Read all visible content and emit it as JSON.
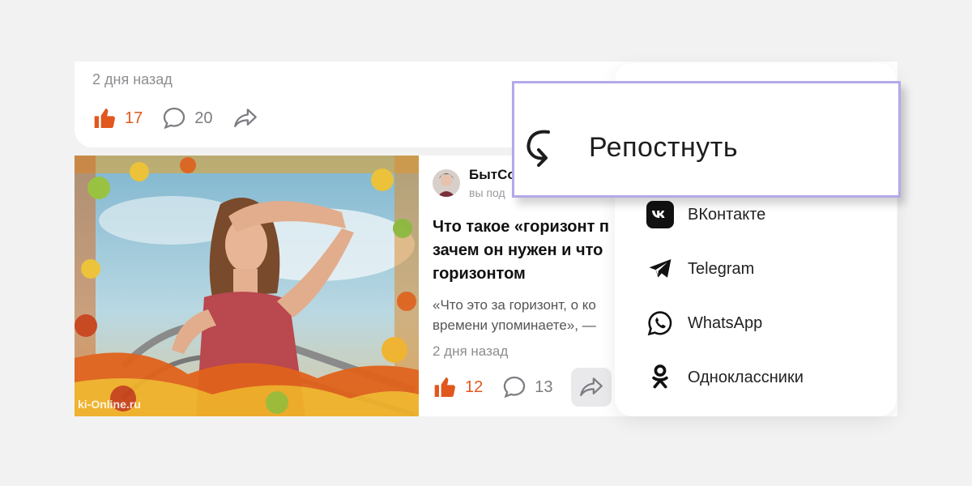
{
  "prev_post": {
    "date": "2 дня назад",
    "likes": "17",
    "comments": "20"
  },
  "post": {
    "author": {
      "name": "БытСо",
      "meta": "вы под"
    },
    "title_lines": [
      "Что такое «горизонт п",
      "зачем он нужен и что",
      "горизонтом"
    ],
    "snippet_lines": [
      "«Что это за горизонт, о ко",
      "времени упоминаете», —"
    ],
    "date": "2 дня назад",
    "likes": "12",
    "comments": "13",
    "image_watermark": "ki-Online.ru"
  },
  "share_menu": {
    "items": [
      {
        "label": "ВКонтакте",
        "icon": "vk-icon"
      },
      {
        "label": "Telegram",
        "icon": "telegram-icon"
      },
      {
        "label": "WhatsApp",
        "icon": "whatsapp-icon"
      },
      {
        "label": "Одноклассники",
        "icon": "odnoklassniki-icon"
      }
    ]
  },
  "repost": {
    "label": "Репостнуть",
    "icon": "repost-icon",
    "border_color": "#b5a8e8"
  },
  "colors": {
    "like": "#e0581d",
    "background": "#f2f2f3"
  }
}
